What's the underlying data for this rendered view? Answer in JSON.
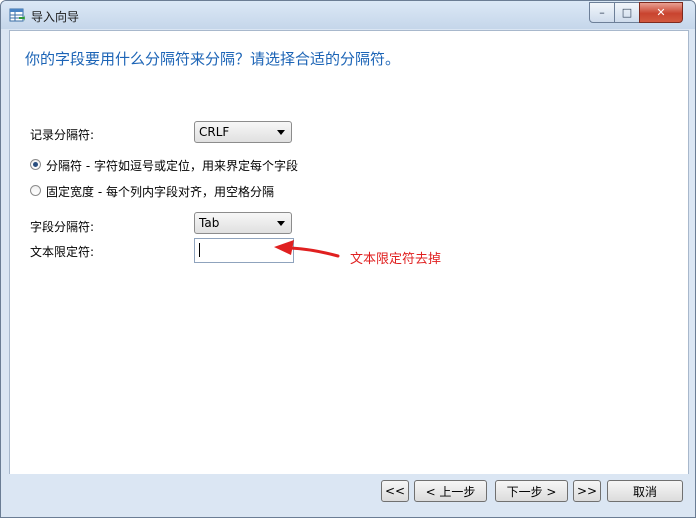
{
  "window": {
    "title": "导入向导",
    "minimize_glyph": "–",
    "maximize_glyph": "□",
    "close_glyph": "✕"
  },
  "main": {
    "heading": "你的字段要用什么分隔符来分隔？请选择合适的分隔符。",
    "record_delimiter": {
      "label": "记录分隔符:",
      "value": "CRLF"
    },
    "options": [
      {
        "label": "分隔符 - 字符如逗号或定位，用来界定每个字段",
        "selected": true
      },
      {
        "label": "固定宽度 - 每个列内字段对齐，用空格分隔",
        "selected": false
      }
    ],
    "field_delimiter": {
      "label": "字段分隔符:",
      "value": "Tab"
    },
    "text_qualifier": {
      "label": "文本限定符:",
      "value": ""
    },
    "annotation": {
      "text": "文本限定符去掉",
      "color": "#e02020"
    }
  },
  "footer": {
    "buttons": {
      "first": "<<",
      "prev": "< 上一步",
      "next": "下一步 >",
      "last": ">>",
      "cancel": "取消"
    }
  },
  "colors": {
    "heading": "#1c64b6",
    "chrome": "#dbe6f3"
  }
}
